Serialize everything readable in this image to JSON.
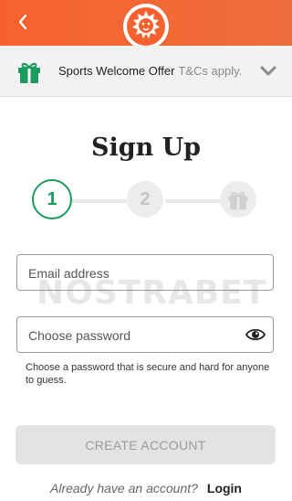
{
  "header": {
    "back_icon": "chevron-left-icon",
    "logo_icon": "lion-logo-icon",
    "brand_color": "#f4622f"
  },
  "offer": {
    "icon": "gift-icon",
    "title": "Sports Welcome Offer",
    "terms": "T&Cs apply.",
    "toggle_icon": "chevron-down-icon"
  },
  "page": {
    "title": "Sign Up"
  },
  "steps": {
    "items": [
      {
        "label": "1",
        "state": "active"
      },
      {
        "label": "2",
        "state": "inactive"
      },
      {
        "label": "",
        "icon": "gift-icon",
        "state": "inactive"
      }
    ],
    "active_color": "#1a9b5c"
  },
  "form": {
    "email": {
      "placeholder": "Email address",
      "value": ""
    },
    "password": {
      "placeholder": "Choose password",
      "value": "",
      "toggle_icon": "eye-icon"
    },
    "password_hint": "Choose a password that is secure and hard for anyone to guess.",
    "submit_label": "CREATE ACCOUNT"
  },
  "footer": {
    "question": "Already have an account?",
    "login_label": "Login"
  },
  "watermark": "NOSTRABET"
}
